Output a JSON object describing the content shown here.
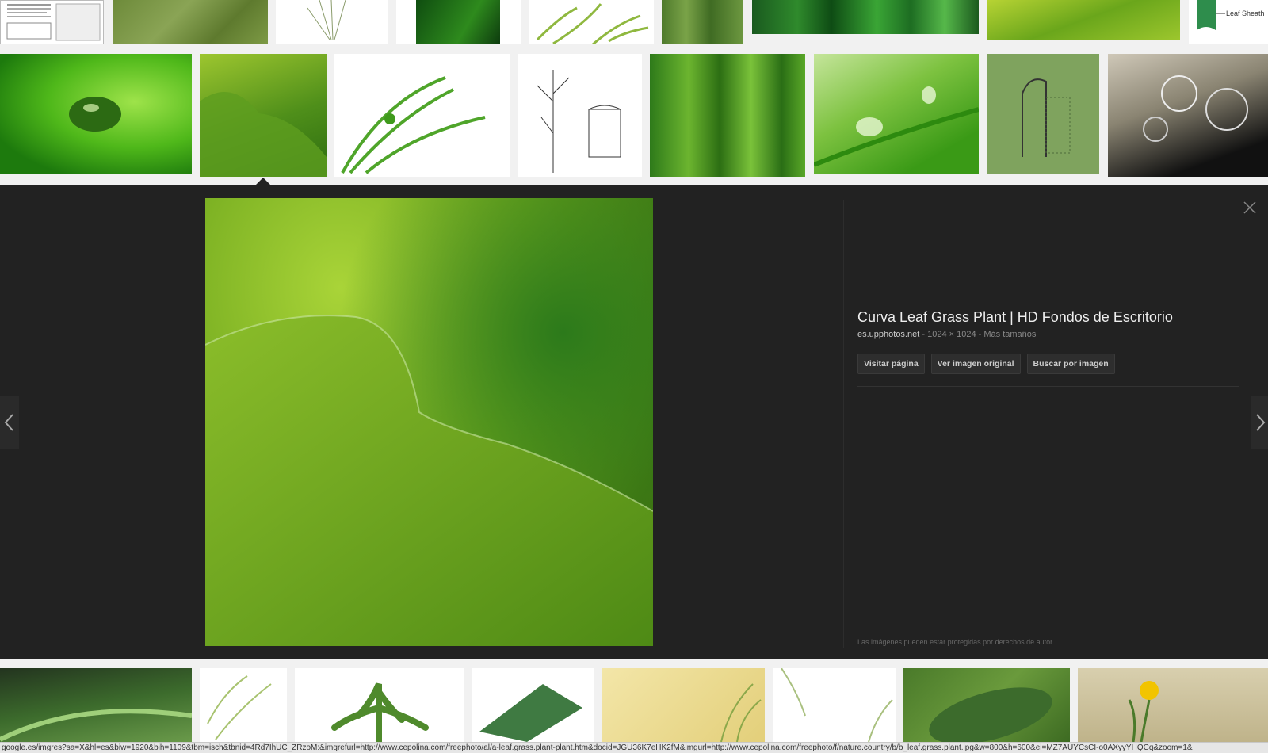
{
  "detail": {
    "title": "Curva Leaf Grass Plant | HD Fondos de Escritorio",
    "site": "es.upphotos.net",
    "dimensions": "1024 × 1024",
    "more_sizes": "Más tamaños",
    "buttons": {
      "visit": "Visitar página",
      "view_original": "Ver imagen original",
      "search_by_image": "Buscar por imagen"
    },
    "copyright": "Las imágenes pueden estar protegidas por derechos de autor."
  },
  "thumb_labels": {
    "leaf_sheath": "Leaf Sheath"
  },
  "status_url": "google.es/imgres?sa=X&hl=es&biw=1920&bih=1109&tbm=isch&tbnid=4Rd7IhUC_ZRzoM:&imgrefurl=http://www.cepolina.com/freephoto/al/a-leaf.grass.plant-plant.htm&docid=JGU36K7eHK2fM&imgurl=http://www.cepolina.com/freephoto/f/nature.country/b/b_leaf.grass.plant.jpg&w=800&h=600&ei=MZ7AUYCsCI-o0AXyyYHQCq&zoom=1&",
  "icons": {
    "close": "close-icon",
    "prev": "chevron-left-icon",
    "next": "chevron-right-icon"
  },
  "colors": {
    "panel_bg": "#222222",
    "accent_green": "#7cb82f"
  }
}
